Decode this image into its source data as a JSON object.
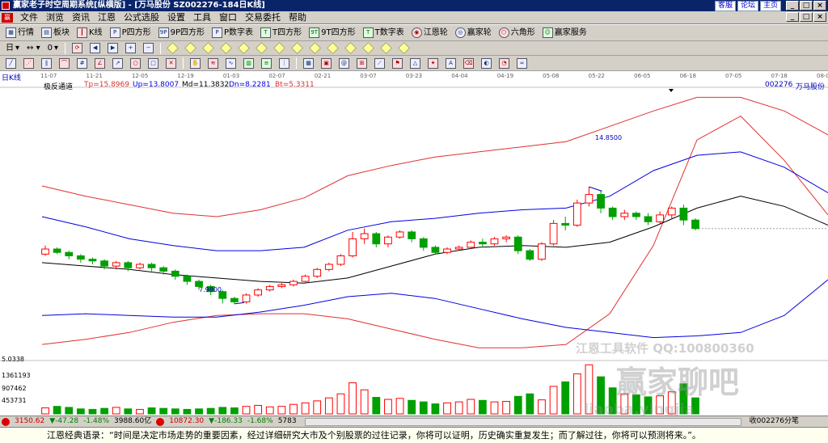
{
  "window": {
    "title": "赢家老子时空周期系统[纵横版] - [万马股份  SZ002276-184日K线]",
    "links": [
      "客服",
      "论坛",
      "主页"
    ],
    "controls": [
      "_",
      "□",
      "×"
    ]
  },
  "menu": {
    "items": [
      "文件",
      "浏览",
      "资讯",
      "江恩",
      "公式选股",
      "设置",
      "工具",
      "窗口",
      "交易委托",
      "帮助"
    ],
    "right_controls": [
      "_",
      "□",
      "×"
    ]
  },
  "toolbar1": {
    "items": [
      {
        "label": "行情",
        "icon": "grid-icon"
      },
      {
        "label": "板块",
        "icon": "blocks-icon"
      },
      {
        "label": "K线",
        "icon": "candle-icon"
      },
      {
        "label": "P四方形",
        "icon": "p-square-icon"
      },
      {
        "label": "9P四方形",
        "icon": "9p-square-icon"
      },
      {
        "label": "P数字表",
        "icon": "p-table-icon"
      },
      {
        "label": "T四方形",
        "icon": "t-square-icon"
      },
      {
        "label": "9T四方形",
        "icon": "9t-square-icon"
      },
      {
        "label": "T数字表",
        "icon": "t-table-icon"
      },
      {
        "label": "江恩轮",
        "icon": "gann-wheel-icon"
      },
      {
        "label": "赢家轮",
        "icon": "winner-wheel-icon"
      },
      {
        "label": "六角形",
        "icon": "hexagon-icon"
      },
      {
        "label": "赢家服务",
        "icon": "service-icon"
      }
    ]
  },
  "toolbar2": {
    "period_label": "日",
    "arrow_label": "0"
  },
  "chart": {
    "period_label": "日K线",
    "indicator": {
      "name": "极反通道",
      "tp": "Tp=15.8969",
      "up": "Up=13.8007",
      "md": "Md=11.3832",
      "dn": "Dn=8.2281",
      "bt": "Bt=5.3311"
    },
    "stock_code": "002276",
    "stock_name": "万马股份",
    "date_ticks": [
      "11-07",
      "11-21",
      "12-05",
      "12-19",
      "01-03",
      "02-07",
      "02-21",
      "03-07",
      "03-23",
      "04-04",
      "04-19",
      "05-08",
      "05-22",
      "06-05",
      "06-18",
      "07-05",
      "07-18",
      "08-02"
    ],
    "high_label": "14.8500",
    "low_label": "7.9800",
    "price_axis_bottom": "5.0338",
    "volume_ticks": [
      "1361193",
      "907462",
      "453731"
    ],
    "colors": {
      "up_candle": "#ff0000",
      "down_candle": "#00a000",
      "upper_band": "#e03030",
      "mid_band": "#0000e0",
      "center_line": "#000000"
    }
  },
  "chart_data": {
    "type": "candlestick",
    "title": "",
    "series": [
      {
        "name": "Tp",
        "values": [
          5.6,
          5.9,
          6.3,
          6.9,
          7.3,
          7.4,
          7.4,
          7.1,
          6.5,
          5.9,
          5.4,
          5.4,
          5.6,
          7.4,
          11.4,
          17.6,
          19.0,
          16.4,
          13.2
        ]
      },
      {
        "name": "Up",
        "values": [
          7.3,
          7.4,
          7.3,
          7.2,
          7.2,
          7.5,
          7.9,
          8.4,
          8.6,
          8.3,
          7.7,
          7.1,
          6.6,
          6.3,
          6.0,
          6.1,
          6.3,
          7.3,
          9.4
        ]
      },
      {
        "name": "Md",
        "values": [
          10.4,
          10.2,
          10.0,
          9.7,
          9.5,
          9.3,
          9.2,
          9.5,
          10.2,
          10.9,
          11.3,
          11.4,
          11.3,
          11.6,
          12.5,
          13.6,
          14.3,
          13.7,
          12.6
        ]
      },
      {
        "name": "Dn",
        "values": [
          13.1,
          12.5,
          11.8,
          11.4,
          11.1,
          11.1,
          11.3,
          12.3,
          12.8,
          13.0,
          13.3,
          13.5,
          13.6,
          14.3,
          15.8,
          16.7,
          16.9,
          16.0,
          14.5
        ]
      },
      {
        "name": "Bt",
        "values": [
          14.9,
          14.3,
          13.8,
          13.3,
          13.1,
          13.5,
          14.2,
          15.5,
          16.1,
          16.6,
          16.9,
          17.2,
          17.5,
          18.4,
          19.3,
          20.1,
          20.1,
          19.3,
          17.9
        ]
      }
    ],
    "candles": [
      {
        "o": 10.9,
        "c": 11.2,
        "h": 11.4,
        "l": 10.8
      },
      {
        "o": 11.2,
        "c": 11.0,
        "h": 11.3,
        "l": 10.9
      },
      {
        "o": 11.0,
        "c": 10.8,
        "h": 11.1,
        "l": 10.6
      },
      {
        "o": 10.8,
        "c": 10.6,
        "h": 10.9,
        "l": 10.4
      },
      {
        "o": 10.6,
        "c": 10.5,
        "h": 10.7,
        "l": 10.3
      },
      {
        "o": 10.5,
        "c": 10.2,
        "h": 10.6,
        "l": 10.0
      },
      {
        "o": 10.2,
        "c": 10.4,
        "h": 10.5,
        "l": 10.0
      },
      {
        "o": 10.4,
        "c": 10.1,
        "h": 10.5,
        "l": 9.9
      },
      {
        "o": 10.1,
        "c": 10.3,
        "h": 10.4,
        "l": 10.0
      },
      {
        "o": 10.3,
        "c": 10.1,
        "h": 10.4,
        "l": 9.9
      },
      {
        "o": 10.1,
        "c": 9.9,
        "h": 10.2,
        "l": 9.7
      },
      {
        "o": 9.9,
        "c": 9.6,
        "h": 10.0,
        "l": 9.4
      },
      {
        "o": 9.6,
        "c": 9.3,
        "h": 9.7,
        "l": 9.1
      },
      {
        "o": 9.3,
        "c": 9.0,
        "h": 9.4,
        "l": 8.8
      },
      {
        "o": 9.0,
        "c": 8.7,
        "h": 9.1,
        "l": 8.5
      },
      {
        "o": 8.7,
        "c": 8.3,
        "h": 8.8,
        "l": 8.0
      },
      {
        "o": 8.3,
        "c": 8.1,
        "h": 8.4,
        "l": 7.98
      },
      {
        "o": 8.1,
        "c": 8.5,
        "h": 8.6,
        "l": 8.0
      },
      {
        "o": 8.5,
        "c": 8.8,
        "h": 8.9,
        "l": 8.4
      },
      {
        "o": 8.8,
        "c": 9.0,
        "h": 9.1,
        "l": 8.7
      },
      {
        "o": 9.0,
        "c": 9.1,
        "h": 9.2,
        "l": 8.9
      },
      {
        "o": 9.1,
        "c": 9.3,
        "h": 9.4,
        "l": 9.0
      },
      {
        "o": 9.3,
        "c": 9.6,
        "h": 9.7,
        "l": 9.2
      },
      {
        "o": 9.6,
        "c": 10.0,
        "h": 10.1,
        "l": 9.5
      },
      {
        "o": 10.0,
        "c": 10.3,
        "h": 10.4,
        "l": 9.9
      },
      {
        "o": 10.3,
        "c": 10.8,
        "h": 10.9,
        "l": 10.2
      },
      {
        "o": 10.8,
        "c": 11.8,
        "h": 12.2,
        "l": 10.7
      },
      {
        "o": 11.8,
        "c": 12.1,
        "h": 12.4,
        "l": 11.5
      },
      {
        "o": 12.1,
        "c": 11.5,
        "h": 12.2,
        "l": 11.3
      },
      {
        "o": 11.5,
        "c": 11.9,
        "h": 12.0,
        "l": 11.3
      },
      {
        "o": 11.9,
        "c": 12.2,
        "h": 12.3,
        "l": 11.8
      },
      {
        "o": 12.2,
        "c": 11.8,
        "h": 12.3,
        "l": 11.6
      },
      {
        "o": 11.8,
        "c": 11.3,
        "h": 11.9,
        "l": 11.1
      },
      {
        "o": 11.3,
        "c": 11.0,
        "h": 11.4,
        "l": 10.9
      },
      {
        "o": 11.0,
        "c": 11.2,
        "h": 11.3,
        "l": 10.9
      },
      {
        "o": 11.2,
        "c": 11.3,
        "h": 11.4,
        "l": 11.1
      },
      {
        "o": 11.3,
        "c": 11.6,
        "h": 11.7,
        "l": 11.2
      },
      {
        "o": 11.6,
        "c": 11.5,
        "h": 11.8,
        "l": 11.3
      },
      {
        "o": 11.5,
        "c": 11.8,
        "h": 11.9,
        "l": 11.4
      },
      {
        "o": 11.8,
        "c": 11.9,
        "h": 12.0,
        "l": 11.6
      },
      {
        "o": 11.9,
        "c": 11.1,
        "h": 12.0,
        "l": 10.9
      },
      {
        "o": 11.1,
        "c": 10.6,
        "h": 11.2,
        "l": 10.5
      },
      {
        "o": 10.6,
        "c": 11.5,
        "h": 11.6,
        "l": 10.5
      },
      {
        "o": 11.5,
        "c": 12.7,
        "h": 12.9,
        "l": 11.4
      },
      {
        "o": 12.7,
        "c": 12.6,
        "h": 13.1,
        "l": 12.3
      },
      {
        "o": 12.6,
        "c": 13.9,
        "h": 14.1,
        "l": 12.5
      },
      {
        "o": 13.9,
        "c": 14.4,
        "h": 14.85,
        "l": 13.7
      },
      {
        "o": 14.4,
        "c": 13.6,
        "h": 14.6,
        "l": 13.3
      },
      {
        "o": 13.6,
        "c": 13.1,
        "h": 13.7,
        "l": 12.9
      },
      {
        "o": 13.1,
        "c": 13.3,
        "h": 13.5,
        "l": 12.9
      },
      {
        "o": 13.3,
        "c": 13.1,
        "h": 13.4,
        "l": 12.9
      },
      {
        "o": 13.1,
        "c": 12.8,
        "h": 13.3,
        "l": 12.6
      },
      {
        "o": 12.8,
        "c": 13.2,
        "h": 13.4,
        "l": 12.7
      },
      {
        "o": 13.2,
        "c": 13.6,
        "h": 13.7,
        "l": 13.0
      },
      {
        "o": 13.6,
        "c": 12.9,
        "h": 13.8,
        "l": 12.6
      },
      {
        "o": 12.9,
        "c": 12.4,
        "h": 13.0,
        "l": 12.3
      }
    ],
    "volumes": [
      0.12,
      0.15,
      0.13,
      0.1,
      0.09,
      0.11,
      0.13,
      0.1,
      0.09,
      0.12,
      0.11,
      0.1,
      0.09,
      0.1,
      0.11,
      0.13,
      0.12,
      0.15,
      0.17,
      0.14,
      0.15,
      0.19,
      0.22,
      0.26,
      0.32,
      0.4,
      0.62,
      0.48,
      0.33,
      0.29,
      0.31,
      0.27,
      0.24,
      0.2,
      0.22,
      0.24,
      0.29,
      0.27,
      0.24,
      0.25,
      0.35,
      0.4,
      0.28,
      0.55,
      0.64,
      0.8,
      0.98,
      0.74,
      0.52,
      0.4,
      0.38,
      0.34,
      0.36,
      0.44,
      0.6,
      0.32
    ],
    "ylim": [
      5.0338,
      20.5
    ]
  },
  "status": {
    "sh_index": "3150.62",
    "sh_change": "▼-47.28",
    "sh_pct": "-1.48%",
    "sh_amount": "3988.60亿",
    "sz_index": "10872.30",
    "sz_change": "▼-186.33",
    "sz_pct": "-1.68%",
    "sz_amount": "5783",
    "right_text": "收002276分笔"
  },
  "quote": {
    "text": "江恩经典语录：“时间是决定市场走势的重要因素，经过详细研究大市及个别股票的过往记录，你将可以证明，历史确实重复发生；而了解过往，你将可以预测将来。”。"
  },
  "watermarks": {
    "brand": "江恩工具软件  QQ:100800360",
    "site": "赢家聊吧",
    "url": "liaoba.yingjia"
  }
}
